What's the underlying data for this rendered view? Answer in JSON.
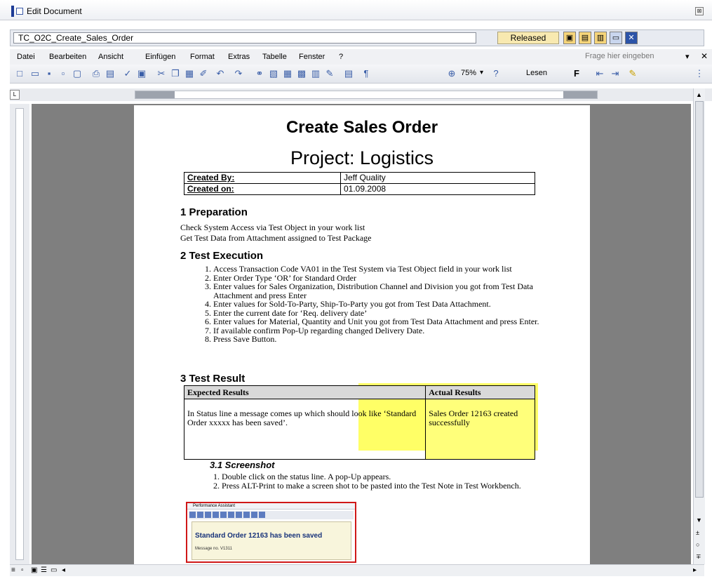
{
  "window": {
    "title": "Edit Document"
  },
  "doc_bar": {
    "doc_name": "TC_O2C_Create_Sales_Order",
    "status": "Released"
  },
  "menu": {
    "items": [
      "Datei",
      "Bearbeiten",
      "Ansicht",
      "Einfügen",
      "Format",
      "Extras",
      "Tabelle",
      "Fenster",
      "?"
    ],
    "ask_placeholder": "Frage hier eingeben"
  },
  "toolbar": {
    "zoom": "75%",
    "read_label": "Lesen"
  },
  "document": {
    "title": "Create Sales Order",
    "subtitle": "Project: Logistics",
    "meta": [
      {
        "key": "Created By:",
        "value": "Jeff Quality"
      },
      {
        "key": "Created on:",
        "value": "01.09.2008"
      }
    ],
    "section1": {
      "heading": "1   Preparation",
      "lines": [
        "Check System Access via Test Object in your work list",
        "Get Test Data from Attachment assigned to Test Package"
      ]
    },
    "section2": {
      "heading": "2   Test Execution",
      "steps": [
        "Access Transaction  Code VA01 in the Test System via Test Object field in your work list",
        "Enter Order Type ‘OR’ for Standard Order",
        "Enter values for Sales Organization, Distribution Channel and Division  you got from Test Data Attachment and press Enter",
        "Enter values for Sold-To-Party, Ship-To-Party you got from Test Data Attachment.",
        "Enter the current date for ‘Req. delivery date’",
        "Enter values for Material, Quantity and Unit you got from Test Data Attachment and press Enter.",
        "If available confirm Pop-Up regarding changed Delivery Date.",
        "Press Save Button."
      ]
    },
    "section3": {
      "heading": "3   Test Result",
      "col_expected": "Expected Results",
      "col_actual": "Actual Results",
      "expected": "In Status line a message comes up which should look like ‘Standard Order xxxxx has been saved’.",
      "actual": "Sales Order 12163 created successfully"
    },
    "section31": {
      "heading": "3.1   Screenshot",
      "steps": [
        "Double click on the status line. A pop-Up appears.",
        "Press ALT-Print to make a screen shot to be pasted into the Test Note in Test Workbench."
      ]
    },
    "screenshot": {
      "window_title": "Performance Assistant",
      "message": "Standard Order 12163 has been saved",
      "message_no": "Message no. V1311"
    }
  }
}
